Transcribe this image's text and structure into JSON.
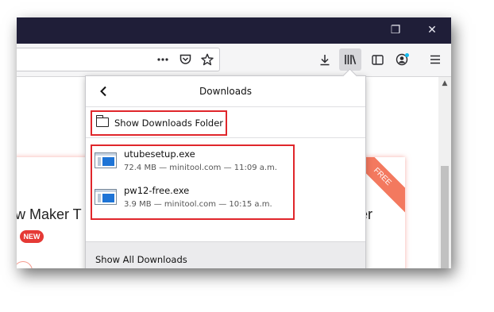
{
  "window": {
    "controls": {
      "restore": "❐",
      "close": "✕"
    }
  },
  "toolbar": {
    "icons": [
      "more-icon",
      "pocket-icon",
      "bookmark-star-icon",
      "download-icon",
      "library-icon",
      "sidebar-icon",
      "account-icon",
      "menu-icon"
    ]
  },
  "page": {
    "left_card_text": "w Maker T",
    "new_badge": "NEW",
    "right_card_text": "er",
    "ribbon_text": "FREE"
  },
  "downloads_panel": {
    "title": "Downloads",
    "show_folder_label": "Show Downloads Folder",
    "items": [
      {
        "name": "utubesetup.exe",
        "meta": "72.4 MB — minitool.com — 11:09 a.m."
      },
      {
        "name": "pw12-free.exe",
        "meta": "3.9 MB — minitool.com — 10:15 a.m."
      }
    ],
    "footer_label": "Show All Downloads"
  },
  "colors": {
    "titlebar": "#1f1e38",
    "highlight_box": "#e0262b",
    "file_icon_blue": "#1e74d6"
  }
}
